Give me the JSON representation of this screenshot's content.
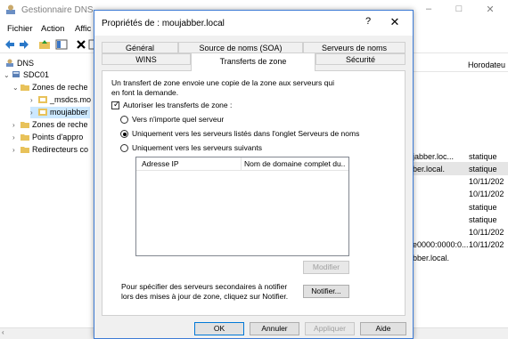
{
  "app": {
    "title": "Gestionnaire DNS",
    "window_controls": [
      "–",
      "□",
      "✕"
    ]
  },
  "menu": {
    "items": [
      "Fichier",
      "Action",
      "Affic"
    ]
  },
  "tree": {
    "items": [
      {
        "label": "DNS",
        "caret": ""
      },
      {
        "label": "SDC01",
        "caret": "⌄"
      },
      {
        "label": "Zones de reche",
        "caret": "⌄"
      },
      {
        "label": "_msdcs.mo",
        "caret": "›"
      },
      {
        "label": "moujabber",
        "caret": "›"
      },
      {
        "label": "Zones de reche",
        "caret": "›"
      },
      {
        "label": "Points d'appro",
        "caret": "›"
      },
      {
        "label": "Redirecteurs co",
        "caret": "›"
      }
    ]
  },
  "right_pane": {
    "column_header": "Horodateu",
    "rows": [
      {
        "left": "jabber.loc...",
        "right": "statique"
      },
      {
        "left": "ber.local.",
        "right": "statique"
      },
      {
        "left": "",
        "right": "10/11/202"
      },
      {
        "left": "",
        "right": "10/11/202"
      },
      {
        "left": "",
        "right": "statique"
      },
      {
        "left": "",
        "right": "statique"
      },
      {
        "left": "",
        "right": "10/11/202"
      },
      {
        "left": "e0000:0000:0...",
        "right": "10/11/202"
      },
      {
        "left": "bber.local.",
        "right": ""
      }
    ]
  },
  "dialog": {
    "title": "Propriétés de : moujabber.local",
    "help": "?",
    "close": "✕",
    "tabs_row1": [
      "Général",
      "Source de noms (SOA)",
      "Serveurs de noms"
    ],
    "tabs_row2": [
      "WINS",
      "Transferts de zone",
      "Sécurité"
    ],
    "description": "Un transfert de zone envoie une copie de la zone aux serveurs qui en font la demande.",
    "allow_checkbox": {
      "label": "Autoriser les transferts de zone :",
      "checked": true
    },
    "radios": [
      {
        "label": "Vers n'importe quel serveur",
        "checked": false
      },
      {
        "label": "Uniquement vers les serveurs listés dans l'onglet Serveurs de noms",
        "checked": true
      },
      {
        "label": "Uniquement vers les serveurs suivants",
        "checked": false
      }
    ],
    "list_columns": [
      "Adresse IP",
      "Nom de domaine complet du..."
    ],
    "modify_button": "Modifier",
    "notify_text": "Pour spécifier des serveurs secondaires à notifier lors des mises à jour de zone, cliquez sur Notifier.",
    "notify_button": "Notifier...",
    "footer_buttons": {
      "ok": "OK",
      "cancel": "Annuler",
      "apply": "Appliquer",
      "help": "Aide"
    }
  }
}
